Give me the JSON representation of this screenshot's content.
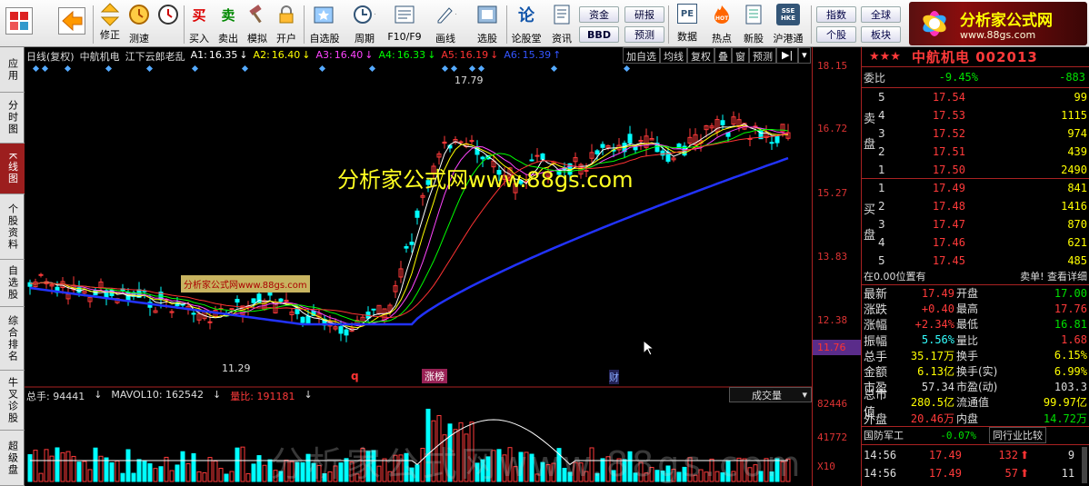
{
  "toolbar": {
    "buttons": [
      {
        "label": "",
        "icon": "grid-icon"
      },
      {
        "label": "",
        "icon": "back-arrow-icon"
      },
      {
        "label": "修正",
        "icon": "up-down-icon"
      },
      {
        "label": "测速",
        "icon": "clock-icon"
      },
      {
        "label": "买入",
        "icon": "buy-icon"
      },
      {
        "label": "卖出",
        "icon": "sell-icon"
      },
      {
        "label": "模拟",
        "icon": "hammer-icon"
      },
      {
        "label": "开户",
        "icon": "lock-icon"
      },
      {
        "label": "自选股",
        "icon": "star-list-icon"
      },
      {
        "label": "周期",
        "icon": "clock-period-icon"
      },
      {
        "label": "F10/F9",
        "icon": "f10-icon"
      },
      {
        "label": "画线",
        "icon": "pencil-icon"
      },
      {
        "label": "选股",
        "icon": "screen-icon"
      },
      {
        "label": "论股堂",
        "icon": "forum-icon"
      },
      {
        "label": "资讯",
        "icon": "news-icon"
      },
      {
        "label": "数据",
        "icon": "pe-icon"
      },
      {
        "label": "热点",
        "icon": "hot-icon"
      },
      {
        "label": "新股",
        "icon": "new-stock-icon"
      },
      {
        "label": "沪港通",
        "icon": "sse-hkex-icon"
      }
    ],
    "small_buttons": [
      "资金",
      "研报",
      "BBD",
      "预测"
    ],
    "right_buttons": [
      "指数",
      "全球",
      "个股",
      "板块"
    ],
    "buy_glyph": "买",
    "sell_glyph": "卖",
    "bbd_glyph": "论",
    "pe_glyph": "PE",
    "sse_glyph": "SSE HKE"
  },
  "logo": {
    "title": "分析家公式网",
    "url": "www.88gs.com"
  },
  "leftnav": [
    "应用",
    "分时图",
    "K线图",
    "个股资料",
    "自选股",
    "综合排名",
    "牛叉诊股",
    "超级盘"
  ],
  "chart_header": {
    "period": "日线(复权)",
    "name": "中航机电",
    "formula": "江下云郎老乱",
    "mas": [
      {
        "label": "A1:",
        "value": "16.35",
        "color": "#ffffff"
      },
      {
        "label": "A2:",
        "value": "16.40",
        "color": "#ffff00"
      },
      {
        "label": "A3:",
        "value": "16.40",
        "color": "#ff44ff"
      },
      {
        "label": "A4:",
        "value": "16.33",
        "color": "#00ff00"
      },
      {
        "label": "A5:",
        "value": "16.19",
        "color": "#ff3333"
      },
      {
        "label": "A6:",
        "value": "15.39",
        "color": "#3355ff"
      }
    ],
    "tools": [
      "加自选",
      "均线",
      "复权",
      "叠",
      "窗",
      "预测"
    ]
  },
  "watermarks": {
    "center": "分析家公式网www.88gs.com",
    "badge": "分析家公式网www.88gs.com",
    "bottom": "分析家公式网www.88gs.com"
  },
  "annotations": {
    "high": "17.79",
    "low": "11.29",
    "q": "q",
    "zt": "涨榜",
    "cai": "财"
  },
  "volume_header": {
    "total": "总手: 94441",
    "mavol": "MAVOL10: 162542",
    "ratio": "量比: 191181",
    "dropdown": "成交量"
  },
  "price_axis": [
    "18.15",
    "16.72",
    "15.27",
    "13.83",
    "12.38"
  ],
  "current_price_tag": "11.76",
  "volume_axis": [
    "82446",
    "41772",
    "X10"
  ],
  "stock": {
    "stars": "★★★",
    "title": "中航机电 002013"
  },
  "weibi": {
    "label": "委比",
    "pct": "-9.45%",
    "diff": "-883"
  },
  "ask_label": "卖盘",
  "bid_label": "买盘",
  "asks": [
    {
      "lvl": "5",
      "price": "17.54",
      "vol": "99"
    },
    {
      "lvl": "4",
      "price": "17.53",
      "vol": "1115"
    },
    {
      "lvl": "3",
      "price": "17.52",
      "vol": "974"
    },
    {
      "lvl": "2",
      "price": "17.51",
      "vol": "439"
    },
    {
      "lvl": "1",
      "price": "17.50",
      "vol": "2490"
    }
  ],
  "bids": [
    {
      "lvl": "1",
      "price": "17.49",
      "vol": "841"
    },
    {
      "lvl": "2",
      "price": "17.48",
      "vol": "1416"
    },
    {
      "lvl": "3",
      "price": "17.47",
      "vol": "870"
    },
    {
      "lvl": "4",
      "price": "17.46",
      "vol": "621"
    },
    {
      "lvl": "5",
      "price": "17.45",
      "vol": "485"
    }
  ],
  "position_text": "在0.00位置有",
  "detail_text": "卖单! 查看详细",
  "quote": [
    {
      "l1": "最新",
      "v1": "17.49",
      "c1": "red",
      "l2": "开盘",
      "v2": "17.00",
      "c2": "grn"
    },
    {
      "l1": "涨跌",
      "v1": "+0.40",
      "c1": "red",
      "l2": "最高",
      "v2": "17.76",
      "c2": "red"
    },
    {
      "l1": "涨幅",
      "v1": "+2.34%",
      "c1": "red",
      "l2": "最低",
      "v2": "16.81",
      "c2": "grn"
    },
    {
      "l1": "振幅",
      "v1": "5.56%",
      "c1": "cya",
      "l2": "量比",
      "v2": "1.68",
      "c2": "red"
    },
    {
      "l1": "总手",
      "v1": "35.17万",
      "c1": "yel",
      "l2": "换手",
      "v2": "6.15%",
      "c2": "yel"
    },
    {
      "l1": "金额",
      "v1": "6.13亿",
      "c1": "yel",
      "l2": "换手(实)",
      "v2": "6.99%",
      "c2": "yel"
    },
    {
      "l1": "市盈",
      "v1": "57.34",
      "c1": "wht",
      "l2": "市盈(动)",
      "v2": "103.3",
      "c2": "wht"
    },
    {
      "l1": "总市值",
      "v1": "280.5亿",
      "c1": "yel",
      "l2": "流通值",
      "v2": "99.97亿",
      "c2": "yel"
    },
    {
      "l1": "外盘",
      "v1": "20.46万",
      "c1": "red",
      "l2": "内盘",
      "v2": "14.72万",
      "c2": "grn"
    }
  ],
  "sector": {
    "name": "国防军工",
    "pct": "-0.07%",
    "compare": "同行业比较"
  },
  "ticks": [
    {
      "time": "14:56",
      "price": "17.49",
      "vol": "132",
      "n": "9"
    },
    {
      "time": "14:56",
      "price": "17.49",
      "vol": "57",
      "n": "11"
    }
  ],
  "colors": {
    "up": "#ff3a3a",
    "down": "#00ffff",
    "ma6": "#2233ff",
    "bg": "#000000"
  }
}
